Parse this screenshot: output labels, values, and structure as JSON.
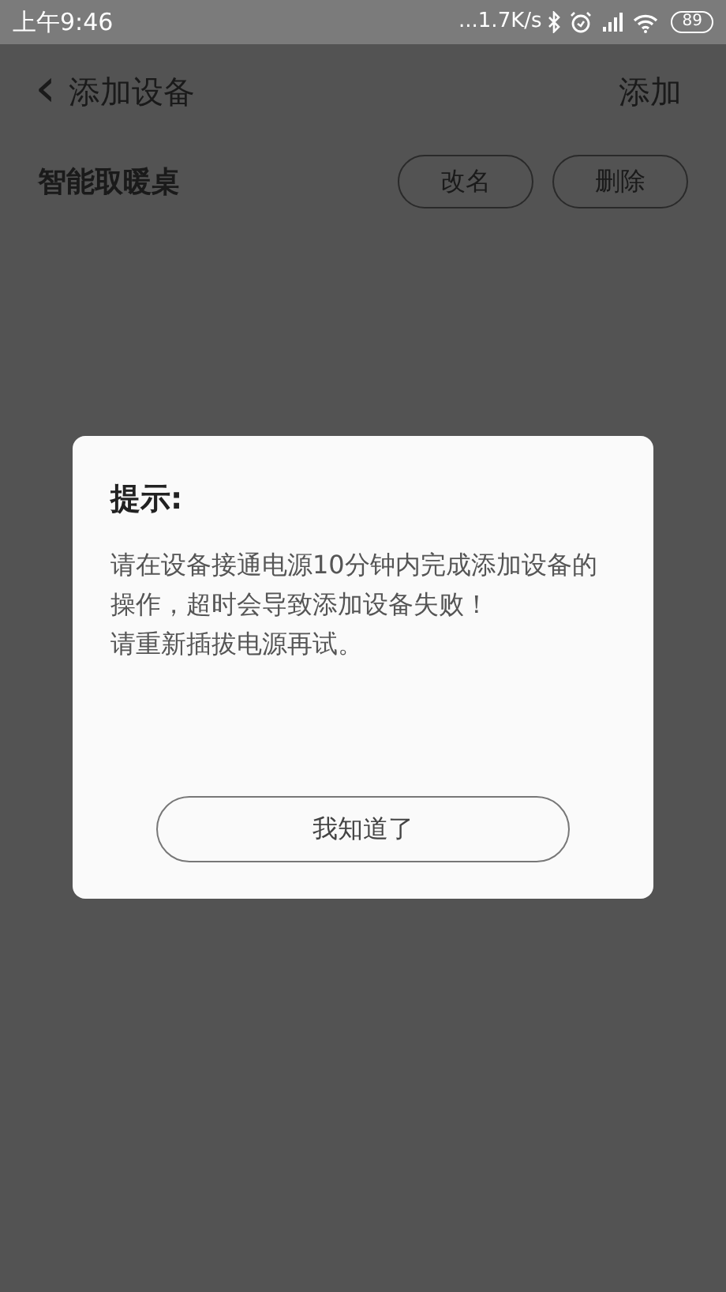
{
  "status_bar": {
    "time": "上午9:46",
    "speed": "...1.7K/s",
    "battery": "89"
  },
  "header": {
    "back_icon": "‹",
    "title": "添加设备",
    "action": "添加"
  },
  "device": {
    "name": "智能取暖桌",
    "buttons": [
      "改名",
      "删除"
    ]
  },
  "dialog": {
    "title": "提示:",
    "paragraphs": [
      "请在设备接通电源10分钟内完成添加设备的操作，超时会导致添加设备失败！",
      "请重新插拔电源再试。"
    ],
    "button": "我知道了"
  }
}
